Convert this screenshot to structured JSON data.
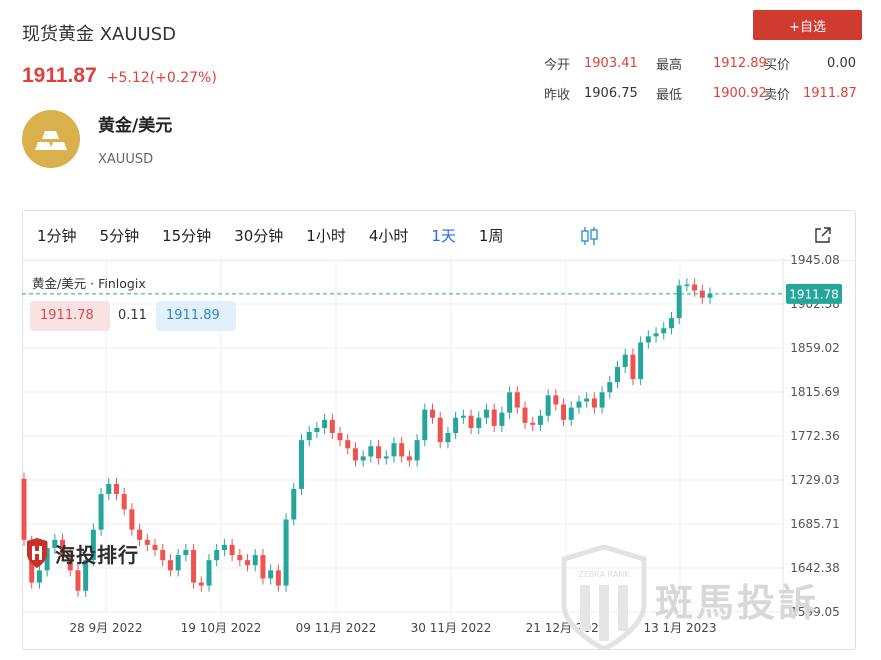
{
  "header": {
    "title": "现货黄金 XAUUSD",
    "add_label": "+自选",
    "price": "1911.87",
    "change": "+5.12(+0.27%)"
  },
  "stats": {
    "open_label": "今开",
    "open": "1903.41",
    "high_label": "最高",
    "high": "1912.89",
    "buy_label": "买价",
    "buy": "0.00",
    "prev_label": "昨收",
    "prev": "1906.75",
    "low_label": "最低",
    "low": "1900.92",
    "sell_label": "卖价",
    "sell": "1911.87"
  },
  "instrument": {
    "name": "黄金/美元",
    "code": "XAUUSD",
    "icon": "gold-bars-icon"
  },
  "toolbar": {
    "timeframes": [
      "1分钟",
      "5分钟",
      "15分钟",
      "30分钟",
      "1小时",
      "4小时",
      "1天",
      "1周"
    ],
    "active": "1天"
  },
  "legend": {
    "symbol": "黄金/美元 · Finlogix",
    "ask": "1911.78",
    "spread": "0.11",
    "bid": "1911.89"
  },
  "colors": {
    "up": "#26a69a",
    "down": "#ef5350",
    "accent": "#2962ff",
    "brand": "#d03b2f"
  },
  "chart_data": {
    "type": "candlestick",
    "y_ticks": [
      "1945.08",
      "1902.38",
      "1859.02",
      "1815.69",
      "1772.36",
      "1729.03",
      "1685.71",
      "1642.38",
      "1599.05"
    ],
    "ylim": [
      1599.05,
      1945.08
    ],
    "x_ticks": [
      "28 9月 2022",
      "19 10月 2022",
      "09 11月 2022",
      "30 11月 2022",
      "21 12月 2022",
      "13 1月 2023"
    ],
    "last_price": "1911.78",
    "candles": [
      [
        1730,
        1670
      ],
      [
        1668,
        1628
      ],
      [
        1628,
        1640
      ],
      [
        1640,
        1662
      ],
      [
        1662,
        1670
      ],
      [
        1670,
        1655
      ],
      [
        1655,
        1640
      ],
      [
        1640,
        1620
      ],
      [
        1620,
        1650
      ],
      [
        1650,
        1680
      ],
      [
        1680,
        1715
      ],
      [
        1715,
        1725
      ],
      [
        1725,
        1715
      ],
      [
        1715,
        1700
      ],
      [
        1700,
        1680
      ],
      [
        1680,
        1670
      ],
      [
        1670,
        1665
      ],
      [
        1665,
        1660
      ],
      [
        1660,
        1650
      ],
      [
        1650,
        1640
      ],
      [
        1640,
        1655
      ],
      [
        1655,
        1660
      ],
      [
        1660,
        1628
      ],
      [
        1628,
        1625
      ],
      [
        1625,
        1650
      ],
      [
        1650,
        1660
      ],
      [
        1660,
        1665
      ],
      [
        1665,
        1655
      ],
      [
        1655,
        1650
      ],
      [
        1650,
        1645
      ],
      [
        1645,
        1655
      ],
      [
        1655,
        1632
      ],
      [
        1632,
        1640
      ],
      [
        1640,
        1625
      ],
      [
        1625,
        1690
      ],
      [
        1690,
        1720
      ],
      [
        1720,
        1768
      ],
      [
        1768,
        1776
      ],
      [
        1776,
        1780
      ],
      [
        1780,
        1788
      ],
      [
        1788,
        1775
      ],
      [
        1775,
        1768
      ],
      [
        1768,
        1760
      ],
      [
        1760,
        1748
      ],
      [
        1748,
        1752
      ],
      [
        1752,
        1762
      ],
      [
        1762,
        1750
      ],
      [
        1750,
        1752
      ],
      [
        1752,
        1765
      ],
      [
        1765,
        1752
      ],
      [
        1752,
        1748
      ],
      [
        1748,
        1768
      ],
      [
        1768,
        1798
      ],
      [
        1798,
        1790
      ],
      [
        1790,
        1766
      ],
      [
        1766,
        1775
      ],
      [
        1775,
        1790
      ],
      [
        1790,
        1792
      ],
      [
        1792,
        1780
      ],
      [
        1780,
        1790
      ],
      [
        1790,
        1798
      ],
      [
        1798,
        1782
      ],
      [
        1782,
        1795
      ],
      [
        1795,
        1815
      ],
      [
        1815,
        1800
      ],
      [
        1800,
        1785
      ],
      [
        1785,
        1783
      ],
      [
        1783,
        1792
      ],
      [
        1792,
        1812
      ],
      [
        1812,
        1803
      ],
      [
        1803,
        1788
      ],
      [
        1788,
        1800
      ],
      [
        1800,
        1806
      ],
      [
        1806,
        1809
      ],
      [
        1809,
        1800
      ],
      [
        1800,
        1815
      ],
      [
        1815,
        1825
      ],
      [
        1825,
        1840
      ],
      [
        1840,
        1852
      ],
      [
        1852,
        1828
      ],
      [
        1828,
        1864
      ],
      [
        1864,
        1870
      ],
      [
        1870,
        1873
      ],
      [
        1873,
        1878
      ],
      [
        1878,
        1888
      ],
      [
        1888,
        1920
      ],
      [
        1920,
        1921
      ],
      [
        1921,
        1915
      ],
      [
        1915,
        1908
      ],
      [
        1908,
        1912
      ]
    ]
  },
  "watermarks": {
    "left": "海投排行",
    "right": "斑馬投訴",
    "badge": "ZEBRA RANK"
  }
}
